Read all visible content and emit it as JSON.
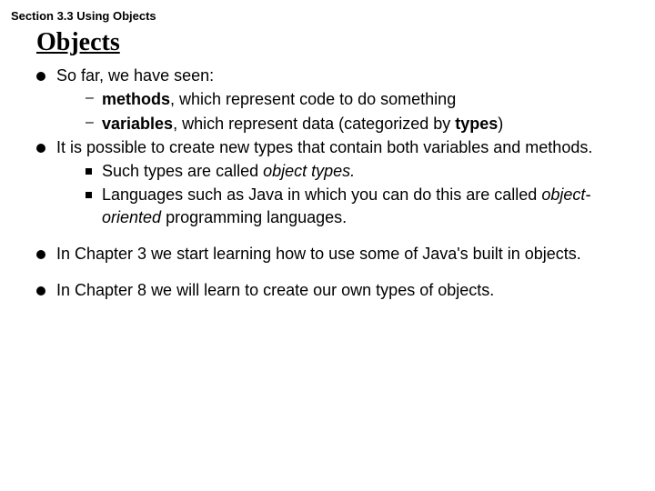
{
  "section_header": "Section 3.3 Using Objects",
  "title": "Objects",
  "b1_intro": "So far, we have seen:",
  "b1_sub1_pre": "methods",
  "b1_sub1_rest": ", which represent code to do something",
  "b1_sub2_pre": "variables",
  "b1_sub2_mid": ", which represent data (categorized by ",
  "b1_sub2_bold": "types",
  "b1_sub2_end": ")",
  "b2_text": "It is possible to create new types that contain both variables and methods.",
  "b2_sub1_pre": "Such types are called ",
  "b2_sub1_ital": "object types.",
  "b2_sub2_pre": "Languages such as Java in which you can do this are called ",
  "b2_sub2_ital": "object-oriented",
  "b2_sub2_post": " programming languages.",
  "b3_text": "In Chapter 3 we start learning how to use some of Java's built in objects.",
  "b4_text": "In Chapter 8 we will learn to create our own types of objects."
}
